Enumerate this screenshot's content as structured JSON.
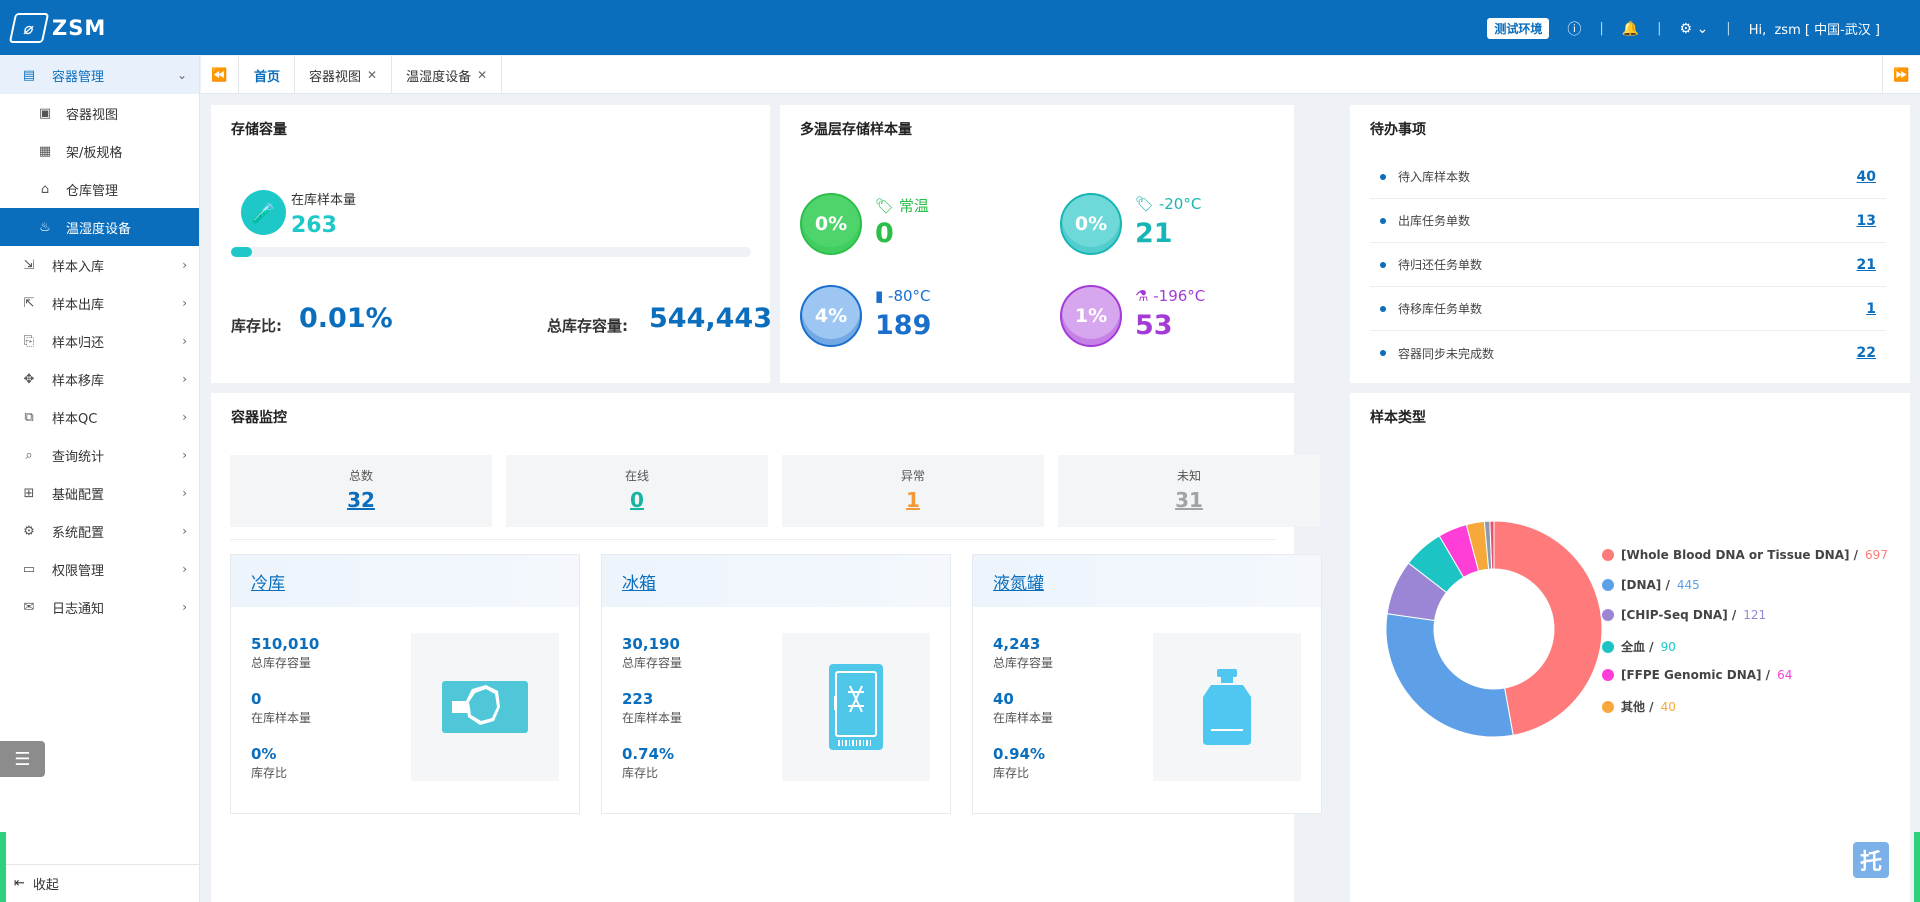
{
  "header": {
    "logo_text": "ZSM",
    "env_badge": "测试环境",
    "greeting": "Hi,",
    "user": "zsm",
    "location": "[ 中国-武汉 ]"
  },
  "sidebar": {
    "groups": [
      {
        "label": "容器管理",
        "icon": "container-icon",
        "open": true
      },
      {
        "label": "样本入库",
        "icon": "import-icon"
      },
      {
        "label": "样本出库",
        "icon": "export-icon"
      },
      {
        "label": "样本归还",
        "icon": "return-icon"
      },
      {
        "label": "样本移库",
        "icon": "move-icon"
      },
      {
        "label": "样本QC",
        "icon": "qc-icon"
      },
      {
        "label": "查询统计",
        "icon": "search-icon"
      },
      {
        "label": "基础配置",
        "icon": "config-icon"
      },
      {
        "label": "系统配置",
        "icon": "gear-icon"
      },
      {
        "label": "权限管理",
        "icon": "id-card-icon"
      },
      {
        "label": "日志通知",
        "icon": "mail-icon"
      }
    ],
    "sub_items": [
      {
        "label": "容器视图",
        "icon": "box-icon"
      },
      {
        "label": "架/板规格",
        "icon": "grid-icon"
      },
      {
        "label": "仓库管理",
        "icon": "warehouse-icon"
      },
      {
        "label": "温湿度设备",
        "icon": "thermometer-icon",
        "active": true
      }
    ],
    "collapse_label": "收起"
  },
  "tabs": [
    {
      "label": "首页",
      "active": true,
      "closable": false
    },
    {
      "label": "容器视图",
      "closable": true
    },
    {
      "label": "温湿度设备",
      "closable": true
    }
  ],
  "storage": {
    "title": "存储容量",
    "in_stock_label": "在库样本量",
    "in_stock_value": "263",
    "progress": 0.0001,
    "ratio_label": "库存比:",
    "ratio_value": "0.01%",
    "total_label": "总库存容量:",
    "total_value": "544,443"
  },
  "multi_temp": {
    "title": "多温层存储样本量",
    "items": [
      {
        "label": "常温",
        "pct": "0%",
        "value": "0",
        "color": "#2bbf4a",
        "bg": "#4fd46b"
      },
      {
        "label": "-20°C",
        "pct": "0%",
        "value": "21",
        "color": "#17b5b5",
        "bg": "#6fd8d8"
      },
      {
        "label": "-80°C",
        "pct": "4%",
        "value": "189",
        "color": "#1a6fcc",
        "bg": "#9ec6f2"
      },
      {
        "label": "-196°C",
        "pct": "1%",
        "value": "53",
        "color": "#a43ad8",
        "bg": "#d6a6ee"
      }
    ]
  },
  "todo": {
    "title": "待办事项",
    "items": [
      {
        "label": "待入库样本数",
        "value": "40"
      },
      {
        "label": "出库任务单数",
        "value": "13"
      },
      {
        "label": "待归还任务单数",
        "value": "21"
      },
      {
        "label": "待移库任务单数",
        "value": "1"
      },
      {
        "label": "容器同步未完成数",
        "value": "22"
      }
    ]
  },
  "monitor": {
    "title": "容器监控",
    "stats": [
      {
        "label": "总数",
        "value": "32",
        "color": "#0a6ebd"
      },
      {
        "label": "在线",
        "value": "0",
        "color": "#17b5a0"
      },
      {
        "label": "异常",
        "value": "1",
        "color": "#f29a3a"
      },
      {
        "label": "未知",
        "value": "31",
        "color": "#a0a4a8"
      }
    ],
    "containers": [
      {
        "title": "冷库",
        "capacity": "510,010",
        "capacity_label": "总库存容量",
        "stock": "0",
        "stock_label": "在库样本量",
        "ratio": "0%",
        "ratio_label": "库存比",
        "icon": "cold-storage-icon"
      },
      {
        "title": "冰箱",
        "capacity": "30,190",
        "capacity_label": "总库存容量",
        "stock": "223",
        "stock_label": "在库样本量",
        "ratio": "0.74%",
        "ratio_label": "库存比",
        "icon": "freezer-icon"
      },
      {
        "title": "液氮罐",
        "capacity": "4,243",
        "capacity_label": "总库存容量",
        "stock": "40",
        "stock_label": "在库样本量",
        "ratio": "0.94%",
        "ratio_label": "库存比",
        "icon": "nitrogen-tank-icon"
      }
    ]
  },
  "sample_types": {
    "title": "样本类型",
    "float_button": "托"
  },
  "chart_data": {
    "type": "pie",
    "categories": [
      "[Whole Blood DNA or Tissue DNA]",
      "[DNA]",
      "[CHIP-Seq DNA]",
      "全血",
      "[FFPE Genomic DNA]",
      "其他"
    ],
    "values": [
      697,
      445,
      121,
      90,
      64,
      40
    ],
    "colors": [
      "#ff7a7a",
      "#5ea0e8",
      "#9b86d6",
      "#1cc4c4",
      "#ff3dd7",
      "#f7a83a"
    ],
    "extra_slices": [
      {
        "value": 12,
        "color": "#8a9bb0"
      },
      {
        "value": 9,
        "color": "#f04f6a"
      }
    ],
    "legend_position": "right"
  }
}
